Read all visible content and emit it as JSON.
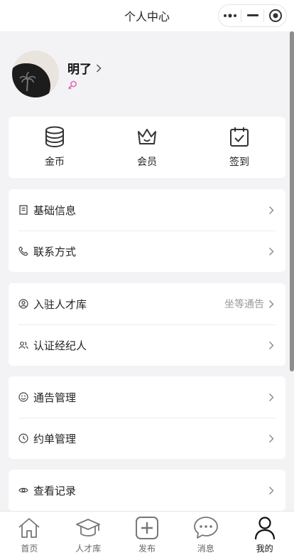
{
  "navbar": {
    "title": "个人中心"
  },
  "profile": {
    "name": "明了"
  },
  "quick_actions": [
    {
      "label": "金币",
      "icon": "coins-icon"
    },
    {
      "label": "会员",
      "icon": "crown-icon"
    },
    {
      "label": "签到",
      "icon": "calendar-check-icon"
    }
  ],
  "groups": [
    {
      "items": [
        {
          "label": "基础信息",
          "icon": "document-icon"
        },
        {
          "label": "联系方式",
          "icon": "phone-icon"
        }
      ]
    },
    {
      "items": [
        {
          "label": "入驻人才库",
          "icon": "user-circle-icon",
          "extra": "坐等通告"
        },
        {
          "label": "认证经纪人",
          "icon": "users-icon"
        }
      ]
    },
    {
      "items": [
        {
          "label": "通告管理",
          "icon": "smile-icon"
        },
        {
          "label": "约单管理",
          "icon": "clock-icon"
        }
      ]
    },
    {
      "items": [
        {
          "label": "查看记录",
          "icon": "eye-icon"
        }
      ]
    }
  ],
  "tabbar": {
    "tabs": [
      {
        "label": "首页",
        "icon": "home-icon"
      },
      {
        "label": "人才库",
        "icon": "graduation-cap-icon"
      },
      {
        "label": "发布",
        "icon": "plus-square-icon"
      },
      {
        "label": "消息",
        "icon": "chat-bubble-icon"
      },
      {
        "label": "我的",
        "icon": "person-icon"
      }
    ],
    "active": "我的"
  },
  "colors": {
    "background": "#f3f3f5",
    "gender_icon": "#e36bb8",
    "text": "#222222",
    "muted": "#999999"
  }
}
